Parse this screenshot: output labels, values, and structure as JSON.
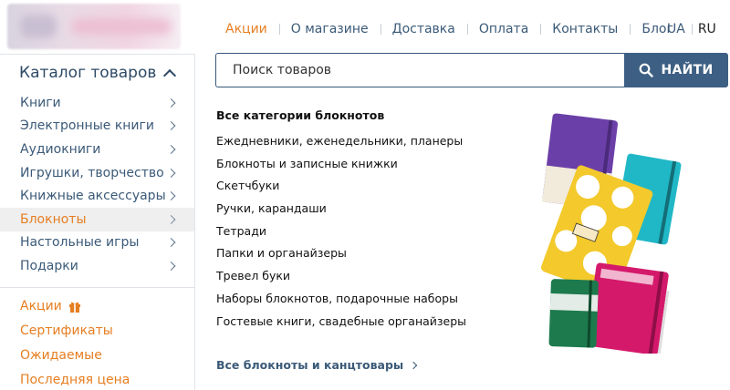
{
  "nav": {
    "items": [
      "Акции",
      "О магазине",
      "Доставка",
      "Оплата",
      "Контакты",
      "Блог"
    ]
  },
  "lang": {
    "ua": "UA",
    "ru": "RU"
  },
  "catalog": {
    "title": "Каталог товаров",
    "items": [
      {
        "label": "Книги"
      },
      {
        "label": "Электронные книги"
      },
      {
        "label": "Аудиокниги"
      },
      {
        "label": "Игрушки, творчество"
      },
      {
        "label": "Книжные аксессуары"
      },
      {
        "label": "Блокноты"
      },
      {
        "label": "Настольные игры"
      },
      {
        "label": "Подарки"
      }
    ],
    "extra": [
      "Акции",
      "Сертификаты",
      "Ожидаемые",
      "Последняя цена"
    ]
  },
  "search": {
    "placeholder": "Поиск товаров",
    "button": "НАЙТИ"
  },
  "dropdown": {
    "heading": "Все категории блокнотов",
    "items": [
      "Ежедневники, еженедельники, планеры",
      "Блокноты и записные книжки",
      "Скетчбуки",
      "Ручки, карандаши",
      "Тетради",
      "Папки и органайзеры",
      "Тревел буки",
      "Наборы блокнотов, подарочные наборы",
      "Гостевые книги, свадебные органайзеры"
    ],
    "all_link": "Все блокноты и канцтовары"
  },
  "colors": {
    "accent": "#e67e22",
    "brand": "#3d5f83",
    "link": "#3b5a78"
  }
}
